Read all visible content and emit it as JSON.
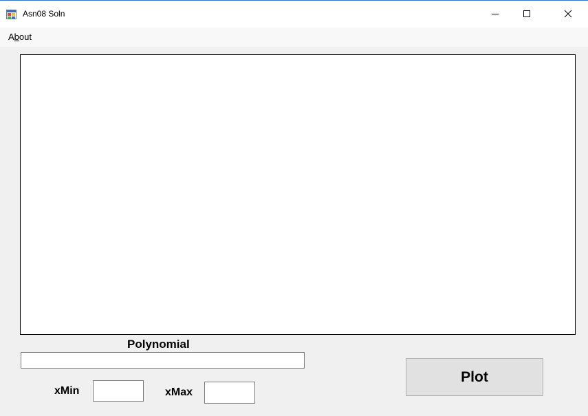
{
  "window": {
    "title": "Asn08 Soln",
    "controls": {
      "minimize": "minimize-icon",
      "maximize": "maximize-icon",
      "close": "close-icon"
    }
  },
  "menu": {
    "items": [
      {
        "label_prefix": "A",
        "label_mnemonic": "b",
        "label_suffix": "out"
      }
    ]
  },
  "form": {
    "polynomial_label": "Polynomial",
    "polynomial_value": "",
    "xmin_label": "xMin",
    "xmin_value": "",
    "xmax_label": "xMax",
    "xmax_value": "",
    "plot_button_label": "Plot"
  },
  "colors": {
    "window_bg": "#f0f0f0",
    "titlebar_bg": "#ffffff",
    "plot_bg": "#ffffff",
    "button_bg": "#e1e1e1",
    "accent_border": "#2b78c7"
  }
}
